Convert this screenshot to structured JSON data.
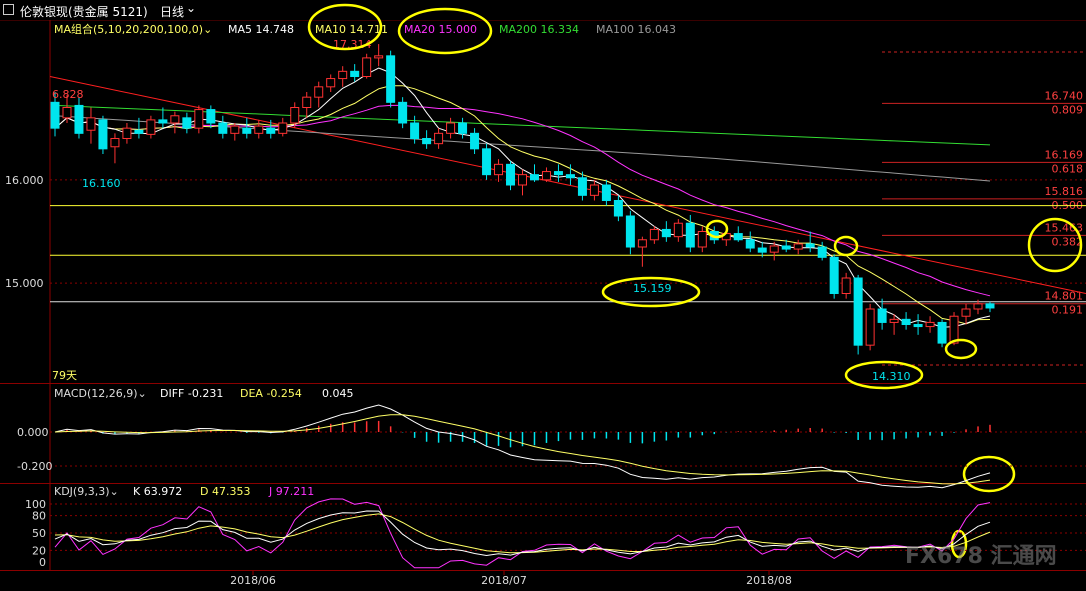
{
  "header": {
    "title": "伦敦银现(贵金属 5121)",
    "period": "日线",
    "colors": {
      "bg": "#000000",
      "up": "#ff3232",
      "down": "#00e5ee",
      "grid": "#8b0000"
    }
  },
  "panel_main": {
    "indicator": "MA组合(5,10,20,200,100,0)",
    "ma_values": [
      {
        "label": "MA5 14.748",
        "color": "#ffffff"
      },
      {
        "label": "MA10 14.711",
        "color": "#ffff66"
      },
      {
        "label": "MA20 15.000",
        "color": "#ff33ff"
      },
      {
        "label": "MA200 16.334",
        "color": "#33dd33"
      },
      {
        "label": "MA100 16.043",
        "color": "#999999"
      }
    ],
    "y_ticks": [
      "16.000",
      "15.000"
    ],
    "price_annotations": [
      "17.314",
      "6.828",
      "16.160",
      "15.159",
      "14.310"
    ],
    "fib_levels": [
      {
        "price": "16.740",
        "ratio": "0.809"
      },
      {
        "price": "16.169",
        "ratio": "0.618"
      },
      {
        "price": "15.816",
        "ratio": "0.500"
      },
      {
        "price": "15.463",
        "ratio": "0.382"
      },
      {
        "price": "14.801",
        "ratio": "0.191"
      }
    ],
    "day_count": "79天"
  },
  "panel_macd": {
    "indicator": "MACD(12,26,9)",
    "diff": "DIFF -0.231",
    "dea": "DEA -0.254",
    "macd": "0.045",
    "y_ticks": [
      "0.000",
      "-0.200"
    ]
  },
  "panel_kdj": {
    "indicator": "KDJ(9,3,3)",
    "k": "K 63.972",
    "d": "D 47.353",
    "j": "J 97.211",
    "y_ticks": [
      "100",
      "80",
      "50",
      "20",
      "0"
    ]
  },
  "x_axis": {
    "labels": [
      "2018/06",
      "2018/07",
      "2018/08"
    ]
  },
  "watermark": "FX678 汇通网",
  "chart_data": {
    "type": "candlestick",
    "ylim": [
      14.15,
      17.45
    ],
    "candles": [
      [
        16.75,
        16.85,
        16.42,
        16.5
      ],
      [
        16.6,
        16.82,
        16.55,
        16.7
      ],
      [
        16.72,
        16.8,
        16.4,
        16.45
      ],
      [
        16.48,
        16.7,
        16.35,
        16.6
      ],
      [
        16.58,
        16.62,
        16.25,
        16.3
      ],
      [
        16.32,
        16.45,
        16.16,
        16.4
      ],
      [
        16.4,
        16.55,
        16.35,
        16.5
      ],
      [
        16.48,
        16.6,
        16.4,
        16.45
      ],
      [
        16.44,
        16.62,
        16.4,
        16.58
      ],
      [
        16.58,
        16.7,
        16.5,
        16.55
      ],
      [
        16.55,
        16.66,
        16.45,
        16.62
      ],
      [
        16.6,
        16.65,
        16.45,
        16.5
      ],
      [
        16.5,
        16.72,
        16.45,
        16.68
      ],
      [
        16.68,
        16.72,
        16.5,
        16.55
      ],
      [
        16.55,
        16.62,
        16.4,
        16.45
      ],
      [
        16.45,
        16.55,
        16.38,
        16.52
      ],
      [
        16.5,
        16.6,
        16.4,
        16.45
      ],
      [
        16.45,
        16.58,
        16.4,
        16.52
      ],
      [
        16.5,
        16.58,
        16.4,
        16.45
      ],
      [
        16.45,
        16.6,
        16.42,
        16.55
      ],
      [
        16.55,
        16.75,
        16.5,
        16.7
      ],
      [
        16.7,
        16.85,
        16.6,
        16.8
      ],
      [
        16.8,
        16.95,
        16.7,
        16.9
      ],
      [
        16.9,
        17.02,
        16.85,
        16.98
      ],
      [
        16.98,
        17.1,
        16.9,
        17.05
      ],
      [
        17.05,
        17.12,
        16.95,
        17.0
      ],
      [
        17.0,
        17.22,
        16.98,
        17.18
      ],
      [
        17.18,
        17.314,
        17.1,
        17.2
      ],
      [
        17.2,
        17.25,
        16.7,
        16.75
      ],
      [
        16.75,
        16.8,
        16.5,
        16.55
      ],
      [
        16.55,
        16.62,
        16.35,
        16.4
      ],
      [
        16.4,
        16.48,
        16.3,
        16.35
      ],
      [
        16.35,
        16.5,
        16.3,
        16.45
      ],
      [
        16.45,
        16.6,
        16.4,
        16.55
      ],
      [
        16.55,
        16.6,
        16.4,
        16.45
      ],
      [
        16.45,
        16.5,
        16.25,
        16.3
      ],
      [
        16.3,
        16.35,
        16.0,
        16.05
      ],
      [
        16.05,
        16.2,
        15.98,
        16.15
      ],
      [
        16.15,
        16.18,
        15.9,
        15.95
      ],
      [
        15.95,
        16.1,
        15.85,
        16.05
      ],
      [
        16.05,
        16.15,
        15.98,
        16.0
      ],
      [
        16.0,
        16.12,
        15.98,
        16.08
      ],
      [
        16.08,
        16.15,
        15.98,
        16.05
      ],
      [
        16.05,
        16.15,
        15.95,
        16.02
      ],
      [
        16.02,
        16.08,
        15.8,
        15.85
      ],
      [
        15.85,
        16.0,
        15.8,
        15.95
      ],
      [
        15.95,
        16.0,
        15.75,
        15.8
      ],
      [
        15.8,
        15.85,
        15.6,
        15.65
      ],
      [
        15.65,
        15.7,
        15.28,
        15.35
      ],
      [
        15.35,
        15.45,
        15.159,
        15.42
      ],
      [
        15.42,
        15.55,
        15.38,
        15.52
      ],
      [
        15.52,
        15.6,
        15.4,
        15.45
      ],
      [
        15.45,
        15.62,
        15.4,
        15.58
      ],
      [
        15.58,
        15.66,
        15.3,
        15.35
      ],
      [
        15.35,
        15.55,
        15.3,
        15.5
      ],
      [
        15.5,
        15.55,
        15.38,
        15.42
      ],
      [
        15.42,
        15.52,
        15.36,
        15.48
      ],
      [
        15.48,
        15.55,
        15.4,
        15.42
      ],
      [
        15.42,
        15.5,
        15.3,
        15.34
      ],
      [
        15.34,
        15.4,
        15.25,
        15.3
      ],
      [
        15.3,
        15.4,
        15.22,
        15.36
      ],
      [
        15.36,
        15.42,
        15.3,
        15.33
      ],
      [
        15.33,
        15.42,
        15.28,
        15.38
      ],
      [
        15.38,
        15.5,
        15.3,
        15.35
      ],
      [
        15.35,
        15.4,
        15.22,
        15.25
      ],
      [
        15.25,
        15.28,
        14.85,
        14.9
      ],
      [
        14.9,
        15.1,
        14.85,
        15.05
      ],
      [
        15.05,
        15.08,
        14.31,
        14.4
      ],
      [
        14.4,
        14.8,
        14.35,
        14.75
      ],
      [
        14.75,
        14.85,
        14.55,
        14.62
      ],
      [
        14.62,
        14.7,
        14.5,
        14.65
      ],
      [
        14.65,
        14.72,
        14.55,
        14.6
      ],
      [
        14.6,
        14.7,
        14.5,
        14.58
      ],
      [
        14.58,
        14.68,
        14.52,
        14.62
      ],
      [
        14.62,
        14.65,
        14.38,
        14.42
      ],
      [
        14.42,
        14.72,
        14.4,
        14.68
      ],
      [
        14.68,
        14.8,
        14.6,
        14.75
      ],
      [
        14.75,
        14.84,
        14.7,
        14.8
      ],
      [
        14.8,
        14.82,
        14.72,
        14.76
      ]
    ]
  }
}
